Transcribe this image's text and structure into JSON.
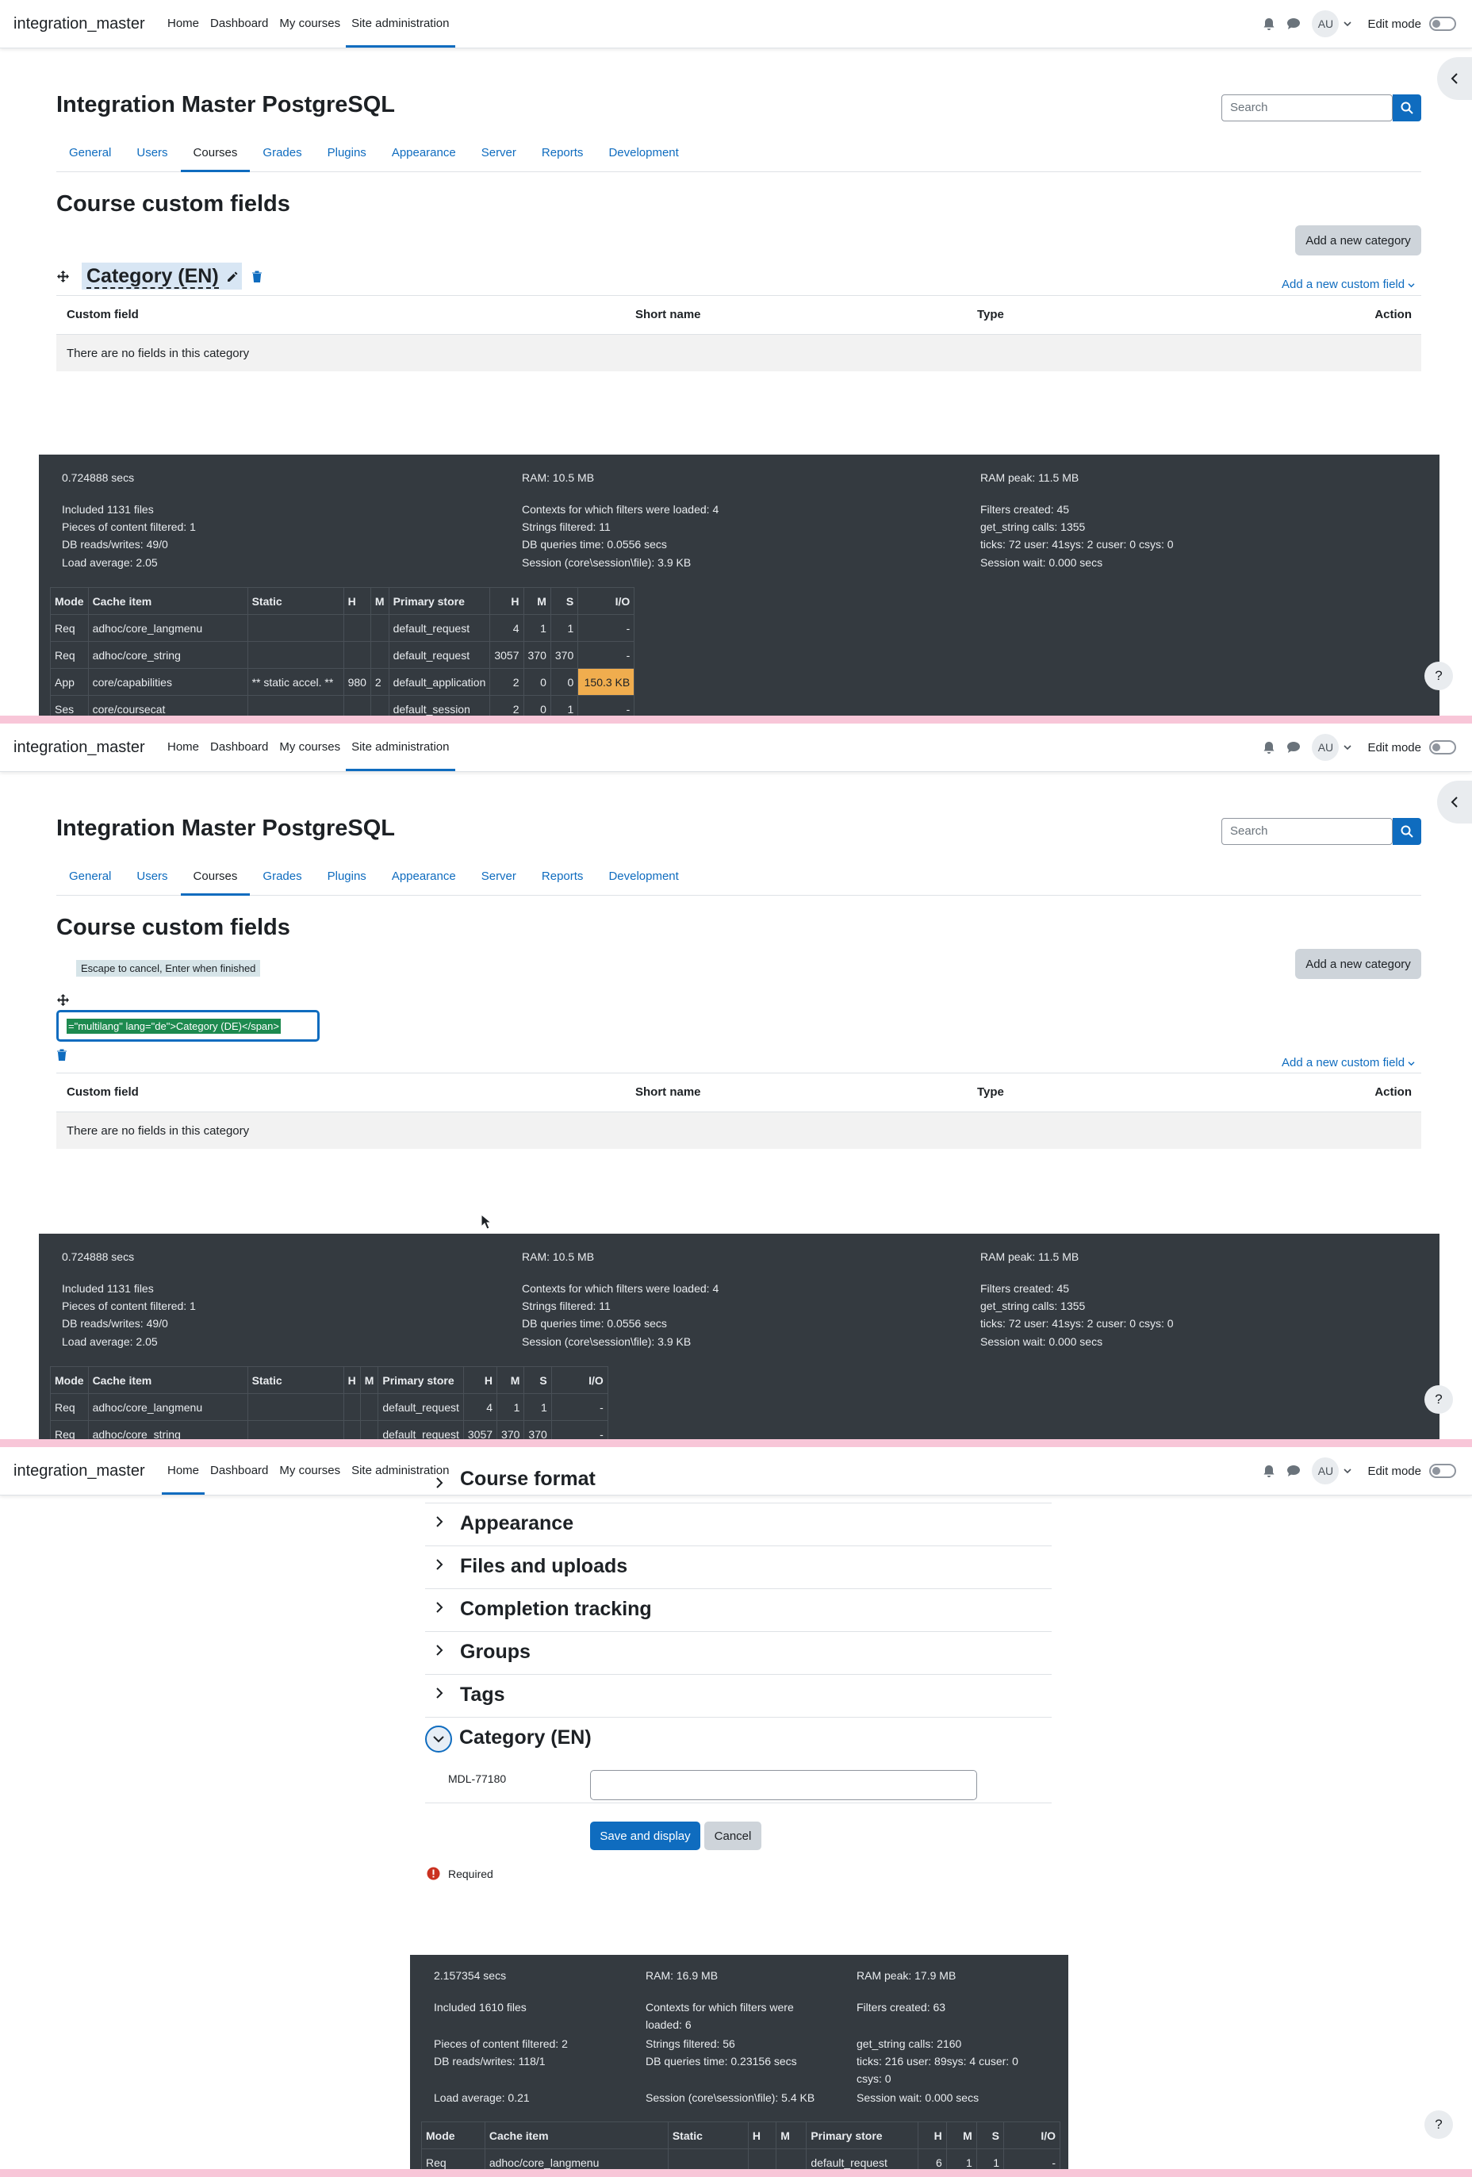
{
  "nav": {
    "brand": "integration_master",
    "links": [
      "Home",
      "Dashboard",
      "My courses",
      "Site administration"
    ],
    "avatar": "AU",
    "edit_mode": "Edit mode"
  },
  "site": {
    "title": "Integration Master PostgreSQL",
    "search_placeholder": "Search",
    "tabs": [
      "General",
      "Users",
      "Courses",
      "Grades",
      "Plugins",
      "Appearance",
      "Server",
      "Reports",
      "Development"
    ]
  },
  "page": {
    "heading": "Course custom fields",
    "add_category": "Add a new category",
    "category_name": "Category (EN)",
    "add_field": "Add a new custom field",
    "columns": [
      "Custom field",
      "Short name",
      "Type",
      "Action"
    ],
    "empty": "There are no fields in this category",
    "edit_hint": "Escape to cancel, Enter when finished",
    "edit_value": "=\"multilang\" lang=\"de\">Category (DE)</span>"
  },
  "perf1": {
    "col1": [
      "0.724888 secs",
      "Included 1131 files",
      "Pieces of content filtered: 1",
      "DB reads/writes: 49/0",
      "Load average: 2.05"
    ],
    "col2": [
      "RAM: 10.5 MB",
      "Contexts for which filters were loaded: 4",
      "Strings filtered: 11",
      "DB queries time: 0.0556 secs",
      "Session (core\\session\\file): 3.9 KB"
    ],
    "col3": [
      "RAM peak: 11.5 MB",
      "Filters created: 45",
      "get_string calls: 1355",
      "ticks: 72 user: 41sys: 2 cuser: 0 csys: 0",
      "Session wait: 0.000 secs"
    ],
    "headers": [
      "Mode",
      "Cache item",
      "Static",
      "H",
      "M",
      "Primary store",
      "H",
      "M",
      "S",
      "I/O"
    ],
    "rows": [
      [
        "Req",
        "adhoc/core_langmenu",
        "",
        "",
        "",
        "default_request",
        "4",
        "1",
        "1",
        "-"
      ],
      [
        "Req",
        "adhoc/core_string",
        "",
        "",
        "",
        "default_request",
        "3057",
        "370",
        "370",
        "-"
      ],
      [
        "App",
        "core/capabilities",
        "** static accel. **",
        "980",
        "2",
        "default_application",
        "2",
        "0",
        "0",
        "150.3 KB"
      ],
      [
        "Ses",
        "core/coursecat",
        "",
        "",
        "",
        "default_session",
        "2",
        "0",
        "1",
        "-"
      ]
    ]
  },
  "form": {
    "sections": [
      "Course format",
      "Appearance",
      "Files and uploads",
      "Completion tracking",
      "Groups",
      "Tags",
      "Category (EN)"
    ],
    "field_label": "MDL-77180",
    "save": "Save and display",
    "cancel": "Cancel",
    "required": "Required"
  },
  "perf3": {
    "col1": [
      "2.157354 secs",
      "Included 1610 files",
      "Pieces of content filtered: 2",
      "DB reads/writes: 118/1",
      "Load average: 0.21"
    ],
    "col2": [
      "RAM: 16.9 MB",
      "Contexts for which filters were",
      "loaded: 6",
      "Strings filtered: 56",
      "DB queries time: 0.23156 secs",
      "Session (core\\session\\file): 5.4 KB"
    ],
    "col3": [
      "RAM peak: 17.9 MB",
      "Filters created: 63",
      "get_string calls: 2160",
      "ticks: 216 user: 89sys: 4 cuser: 0",
      "csys: 0",
      "Session wait: 0.000 secs"
    ],
    "headers": [
      "Mode",
      "Cache item",
      "Static",
      "H",
      "M",
      "Primary store",
      "H",
      "M",
      "S",
      "I/O"
    ],
    "row": [
      "Req",
      "adhoc/core_langmenu",
      "",
      "",
      "",
      "default_request",
      "6",
      "1",
      "1",
      "-"
    ]
  },
  "help": "?",
  "colors": {
    "accent": "#0f6cbf",
    "dark": "#343a40",
    "highlight": "#f0ad4e",
    "separator": "#f8c6d8"
  }
}
